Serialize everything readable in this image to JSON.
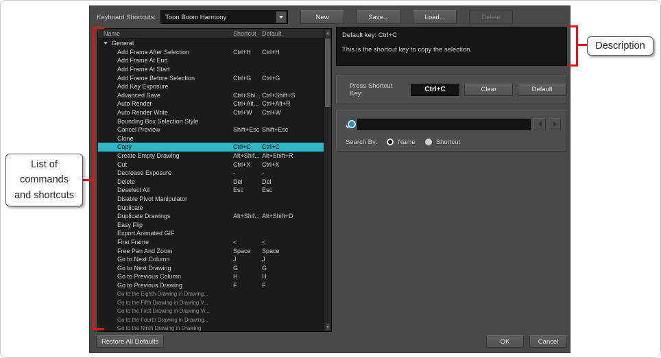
{
  "annotations": {
    "left_label": "List of\ncommands\nand shortcuts",
    "right_label": "Description",
    "accent_color": "#e81010"
  },
  "dialog": {
    "header": {
      "label": "Keyboard Shortcuts:",
      "preset_value": "Toon Boom Harmony",
      "buttons": {
        "new": "New",
        "save": "Save...",
        "load": "Load...",
        "delete": "Delete"
      }
    },
    "list": {
      "columns": [
        "Name",
        "Shortcut",
        "Default"
      ],
      "group": "General",
      "rows": [
        {
          "name": "Add Frame After Selection",
          "shortcut": "Ctrl+H",
          "default": "Ctrl+H"
        },
        {
          "name": "Add Frame At End",
          "shortcut": "",
          "default": ""
        },
        {
          "name": "Add Frame At Start",
          "shortcut": "",
          "default": ""
        },
        {
          "name": "Add Frame Before Selection",
          "shortcut": "Ctrl+G",
          "default": "Ctrl+G"
        },
        {
          "name": "Add Key Exposure",
          "shortcut": "",
          "default": ""
        },
        {
          "name": "Advanced Save",
          "shortcut": "Ctrl+Shi...",
          "default": "Ctrl+Shift+S"
        },
        {
          "name": "Auto Render",
          "shortcut": "Ctrl+Alt...",
          "default": "Ctrl+Alt+R"
        },
        {
          "name": "Auto Render Write",
          "shortcut": "Ctrl+W",
          "default": "Ctrl+W"
        },
        {
          "name": "Bounding Box Selection Style",
          "shortcut": "",
          "default": ""
        },
        {
          "name": "Cancel Preview",
          "shortcut": "Shift+Esc",
          "default": "Shift+Esc"
        },
        {
          "name": "Clone",
          "shortcut": "",
          "default": ""
        },
        {
          "name": "Copy",
          "shortcut": "Ctrl+C",
          "default": "Ctrl+C",
          "selected": true
        },
        {
          "name": "Create Empty Drawing",
          "shortcut": "Alt+Shif...",
          "default": "Alt+Shift+R"
        },
        {
          "name": "Cut",
          "shortcut": "Ctrl+X",
          "default": "Ctrl+X"
        },
        {
          "name": "Decrease Exposure",
          "shortcut": "-",
          "default": "-"
        },
        {
          "name": "Delete",
          "shortcut": "Del",
          "default": "Del"
        },
        {
          "name": "Deselect All",
          "shortcut": "Esc",
          "default": "Esc"
        },
        {
          "name": "Disable Pivot Manipulator",
          "shortcut": "",
          "default": ""
        },
        {
          "name": "Duplicate",
          "shortcut": "",
          "default": ""
        },
        {
          "name": "Duplicate Drawings",
          "shortcut": "Alt+Shif...",
          "default": "Alt+Shift+D"
        },
        {
          "name": "Easy Flip",
          "shortcut": "",
          "default": ""
        },
        {
          "name": "Export Animated GIF",
          "shortcut": "",
          "default": ""
        },
        {
          "name": "First Frame",
          "shortcut": "<",
          "default": "<"
        },
        {
          "name": "Free Pan And Zoom",
          "shortcut": "Space",
          "default": "Space"
        },
        {
          "name": "Go to Next Column",
          "shortcut": "J",
          "default": "J"
        },
        {
          "name": "Go to Next Drawing",
          "shortcut": "G",
          "default": "G"
        },
        {
          "name": "Go to Previous Column",
          "shortcut": "H",
          "default": "H"
        },
        {
          "name": "Go to Previous Drawing",
          "shortcut": "F",
          "default": "F"
        },
        {
          "name": "Go to the Eighth Drawing in Drawing...",
          "shortcut": "",
          "default": "",
          "small": true
        },
        {
          "name": "Go to the Fifth Drawing in Drawing V...",
          "shortcut": "",
          "default": "",
          "small": true
        },
        {
          "name": "Go to the First Drawing in Drawing Vi...",
          "shortcut": "",
          "default": "",
          "small": true
        },
        {
          "name": "Go to the Fourth Drawing in Drawing...",
          "shortcut": "",
          "default": "",
          "small": true
        },
        {
          "name": "Go to the Ninth Drawing in Drawing",
          "shortcut": "",
          "default": "",
          "small": true
        }
      ]
    },
    "description": {
      "line1": "Default key: Ctrl+C",
      "line2": "This is the shortcut key to copy the selection."
    },
    "shortcut_editor": {
      "label": "Press Shortcut Key:",
      "value": "Ctrl+C",
      "clear": "Clear",
      "default": "Default"
    },
    "search": {
      "value": "",
      "label": "Search By:",
      "options": [
        "Name",
        "Shortcut"
      ],
      "selected": "Name"
    },
    "footer": {
      "restore": "Restore All Defaults",
      "ok": "OK",
      "cancel": "Cancel"
    }
  }
}
